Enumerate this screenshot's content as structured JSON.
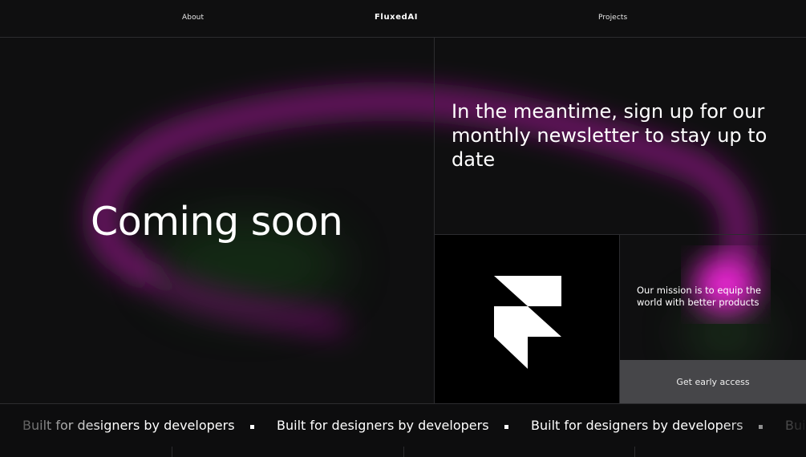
{
  "nav": {
    "about": "About",
    "brand": "FluxedAI",
    "projects": "Projects"
  },
  "hero": {
    "title": "Coming soon"
  },
  "newsletter": {
    "text": "In the meantime, sign up for our monthly newsletter to stay up to date"
  },
  "logo": {
    "icon": "framer-logo-icon"
  },
  "mission": {
    "text": "Our mission is to equip the world with better products"
  },
  "cta": {
    "label": "Get early access"
  },
  "marquee": {
    "items": [
      "Built for designers by developers",
      "Built for designers by developers",
      "Built for designers by developers",
      "Built for designers by developers"
    ]
  },
  "colors": {
    "background": "#0f0f10",
    "glow": "#e21ad0",
    "accent_green": "#2a7a2a",
    "button": "#464649"
  }
}
